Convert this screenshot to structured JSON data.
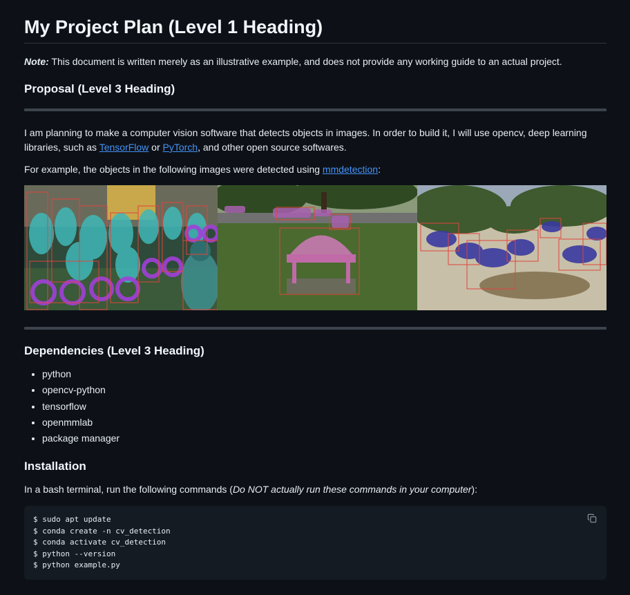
{
  "title": "My Project Plan (Level 1 Heading)",
  "note": {
    "label": "Note:",
    "text": " This document is written merely as an illustrative example, and does not provide any working guide to an actual project."
  },
  "proposal": {
    "heading": "Proposal (Level 3 Heading)",
    "p1_a": "I am planning to make a computer vision software that detects objects in images. In order to build it, I will use opencv, deep learning libraries, such as ",
    "link_tensorflow": "TensorFlow",
    "p1_b": " or ",
    "link_pytorch": "PyTorch",
    "p1_c": ", and other open source softwares.",
    "p2_a": "For example, the objects in the following images were detected using ",
    "link_mmdetection": "mmdetection",
    "p2_b": ":"
  },
  "dependencies": {
    "heading": "Dependencies (Level 3 Heading)",
    "items": [
      "python",
      "opencv-python",
      "tensorflow",
      "openmmlab",
      "package manager"
    ]
  },
  "installation": {
    "heading": "Installation",
    "intro_a": "In a bash terminal, run the following commands (",
    "intro_em": "Do NOT actually run these commands in your computer",
    "intro_b": "):",
    "commands": [
      "$ sudo apt update",
      "$ conda create -n cv_detection",
      "$ conda activate cv_detection",
      "$ python --version",
      "$ python example.py"
    ],
    "copy_icon": "copy-icon"
  },
  "colors": {
    "background": "#0d1117",
    "text": "#e6edf3",
    "link": "#4493f8",
    "code_bg": "#151b23",
    "detection_box": "#e0443e"
  }
}
